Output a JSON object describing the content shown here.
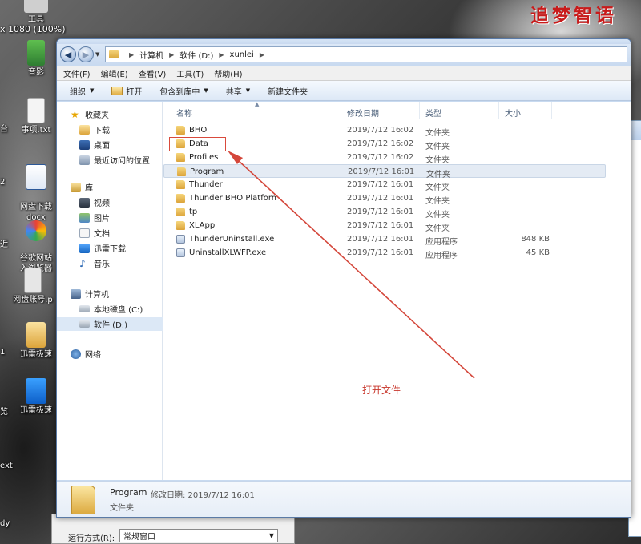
{
  "desktop": {
    "resolution_text": "x 1080 (100%)",
    "brand_text": "追梦智语",
    "icons": [
      {
        "label": "工具"
      },
      {
        "label": "音影"
      },
      {
        "label": "事项.txt"
      },
      {
        "label": "网盘下载\ndocx"
      },
      {
        "label": "谷歌网站\n入浏览器"
      },
      {
        "label": "网盘账号.p"
      },
      {
        "label": "迅雷极速"
      },
      {
        "label": "迅雷极速"
      }
    ],
    "edge_labels": [
      "台",
      "2",
      "近",
      "1",
      "览",
      "ext",
      "dy"
    ]
  },
  "explorer": {
    "address": {
      "crumbs": [
        "计算机",
        "软件 (D:)",
        "xunlei"
      ]
    },
    "menu": [
      "文件(F)",
      "编辑(E)",
      "查看(V)",
      "工具(T)",
      "帮助(H)"
    ],
    "toolbar": {
      "organize": "组织",
      "open": "打开",
      "include": "包含到库中",
      "share": "共享",
      "new_folder": "新建文件夹"
    },
    "nav": {
      "favorites": "收藏夹",
      "downloads": "下载",
      "desktop": "桌面",
      "recent": "最近访问的位置",
      "libraries": "库",
      "videos": "视频",
      "pictures": "图片",
      "documents": "文档",
      "xunlei_dl": "迅雷下载",
      "music": "音乐",
      "computer": "计算机",
      "drive_c": "本地磁盘 (C:)",
      "drive_d": "软件 (D:)",
      "network": "网络"
    },
    "columns": {
      "name": "名称",
      "date": "修改日期",
      "type": "类型",
      "size": "大小"
    },
    "files": [
      {
        "name": "BHO",
        "date": "2019/7/12 16:02",
        "type": "文件夹",
        "size": "",
        "icon": "folder-icon"
      },
      {
        "name": "Data",
        "date": "2019/7/12 16:02",
        "type": "文件夹",
        "size": "",
        "icon": "folder-icon"
      },
      {
        "name": "Profiles",
        "date": "2019/7/12 16:02",
        "type": "文件夹",
        "size": "",
        "icon": "folder-icon"
      },
      {
        "name": "Program",
        "date": "2019/7/12 16:01",
        "type": "文件夹",
        "size": "",
        "icon": "folder-icon"
      },
      {
        "name": "Thunder",
        "date": "2019/7/12 16:01",
        "type": "文件夹",
        "size": "",
        "icon": "folder-icon"
      },
      {
        "name": "Thunder BHO Platform",
        "date": "2019/7/12 16:01",
        "type": "文件夹",
        "size": "",
        "icon": "folder-icon"
      },
      {
        "name": "tp",
        "date": "2019/7/12 16:01",
        "type": "文件夹",
        "size": "",
        "icon": "folder-icon"
      },
      {
        "name": "XLApp",
        "date": "2019/7/12 16:01",
        "type": "文件夹",
        "size": "",
        "icon": "folder-icon"
      },
      {
        "name": "ThunderUninstall.exe",
        "date": "2019/7/12 16:01",
        "type": "应用程序",
        "size": "848 KB",
        "icon": "exe-icon"
      },
      {
        "name": "UninstallXLWFP.exe",
        "date": "2019/7/12 16:01",
        "type": "应用程序",
        "size": "45 KB",
        "icon": "exe-icon"
      }
    ],
    "details": {
      "name": "Program",
      "meta": "修改日期: 2019/7/12 16:01",
      "type": "文件夹"
    }
  },
  "annotation": {
    "text": "打开文件",
    "color": "#c8372c"
  },
  "run_dialog": {
    "label": "运行方式(R):",
    "value": "常规窗口"
  }
}
